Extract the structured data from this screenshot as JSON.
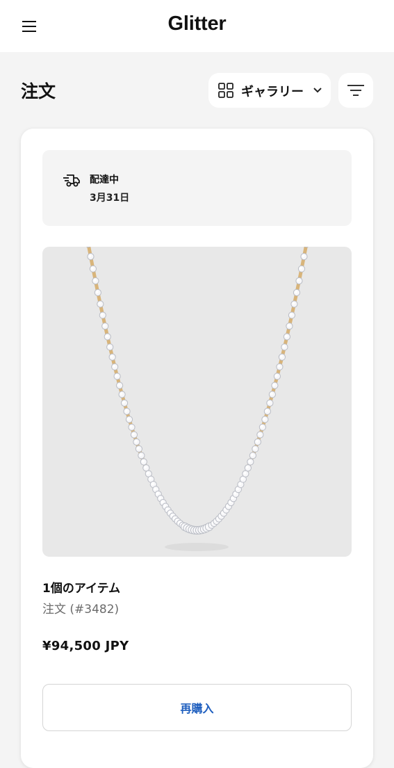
{
  "header": {
    "brand": "Glitter",
    "menu_icon": "hamburger-menu-icon"
  },
  "toolbar": {
    "page_title": "注文",
    "view_toggle_label": "ギャラリー",
    "view_toggle_icon": "grid-icon",
    "filter_icon": "filter-icon"
  },
  "order": {
    "status": {
      "label": "配達中",
      "date": "3月31日",
      "icon": "delivery-truck-icon"
    },
    "item_count": "1個のアイテム",
    "order_number": "注文 (#3482)",
    "price": "¥94,500 JPY",
    "rebuy_label": "再購入",
    "image": "diamond-tennis-necklace"
  },
  "colors": {
    "background": "#f4f4f4",
    "card": "#ffffff",
    "accent_link": "#1f5fbf",
    "muted_text": "#6b6b6b",
    "metal": "#d8b47a"
  }
}
